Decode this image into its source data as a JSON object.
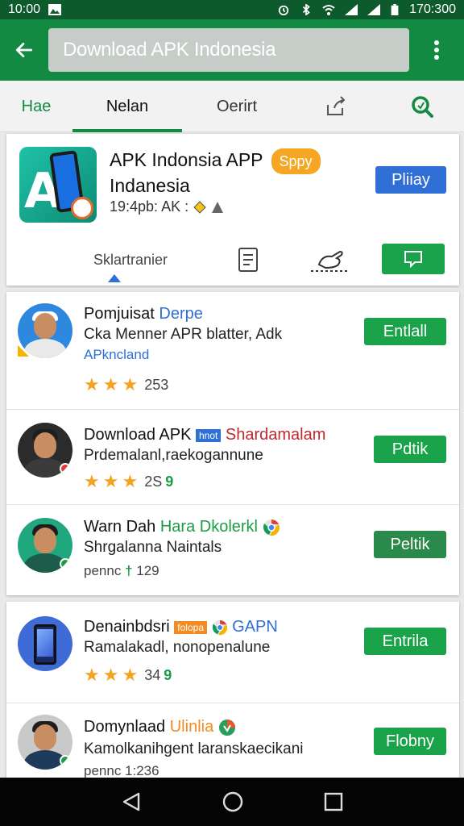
{
  "status_bar": {
    "time": "10:00",
    "right_time": "170:300"
  },
  "app_bar": {
    "search_value": "Download APK Indonesia"
  },
  "tabs": [
    {
      "label": "Hae"
    },
    {
      "label": "Nelan"
    },
    {
      "label": "Oerirt"
    }
  ],
  "featured": {
    "title_line1": "APK Indonsia APP",
    "pill": "Sppy",
    "title_line2": "Indanesia",
    "meta": "19:4pb:  AK :",
    "button": "Pliiay",
    "bar_label": "Sklartranier"
  },
  "list": [
    {
      "title": "Pomjuisat",
      "title_extra": "Derpe",
      "sub": "Cka Menner APR blatter, Adk",
      "link": "APkncland",
      "rating": "253",
      "button": "Entlall"
    },
    {
      "title": "Download APK",
      "tag": "hnot",
      "title_extra": "Shardamalam",
      "sub": "Prdemalanl,raekogannune",
      "rating": "2S",
      "rating_extra": "9",
      "button": "Pdtik"
    },
    {
      "title": "Warn Dah",
      "title_extra": "Hara Dkolerkl",
      "sub": "Shrgalanna Naintals",
      "meta": "pennc",
      "meta_extra": "129",
      "button": "Peltik"
    },
    {
      "title": "Denainbdsri",
      "tag": "folopa",
      "title_extra": "GAPN",
      "sub": "Ramalakadl, nonopenalune",
      "rating": "34",
      "rating_extra": "9",
      "button": "Entrila"
    },
    {
      "title": "Domynlaad",
      "title_extra": "Ulinlia",
      "sub": "Kamolkanihgent laranskaecikani",
      "meta": "pennc 1:236",
      "button": "Flobny"
    }
  ],
  "colors": {
    "primary": "#128a41",
    "primary_dark": "#0d5a2c",
    "install": "#1aa34a",
    "play": "#2f6fd6",
    "star": "#f4a321"
  }
}
